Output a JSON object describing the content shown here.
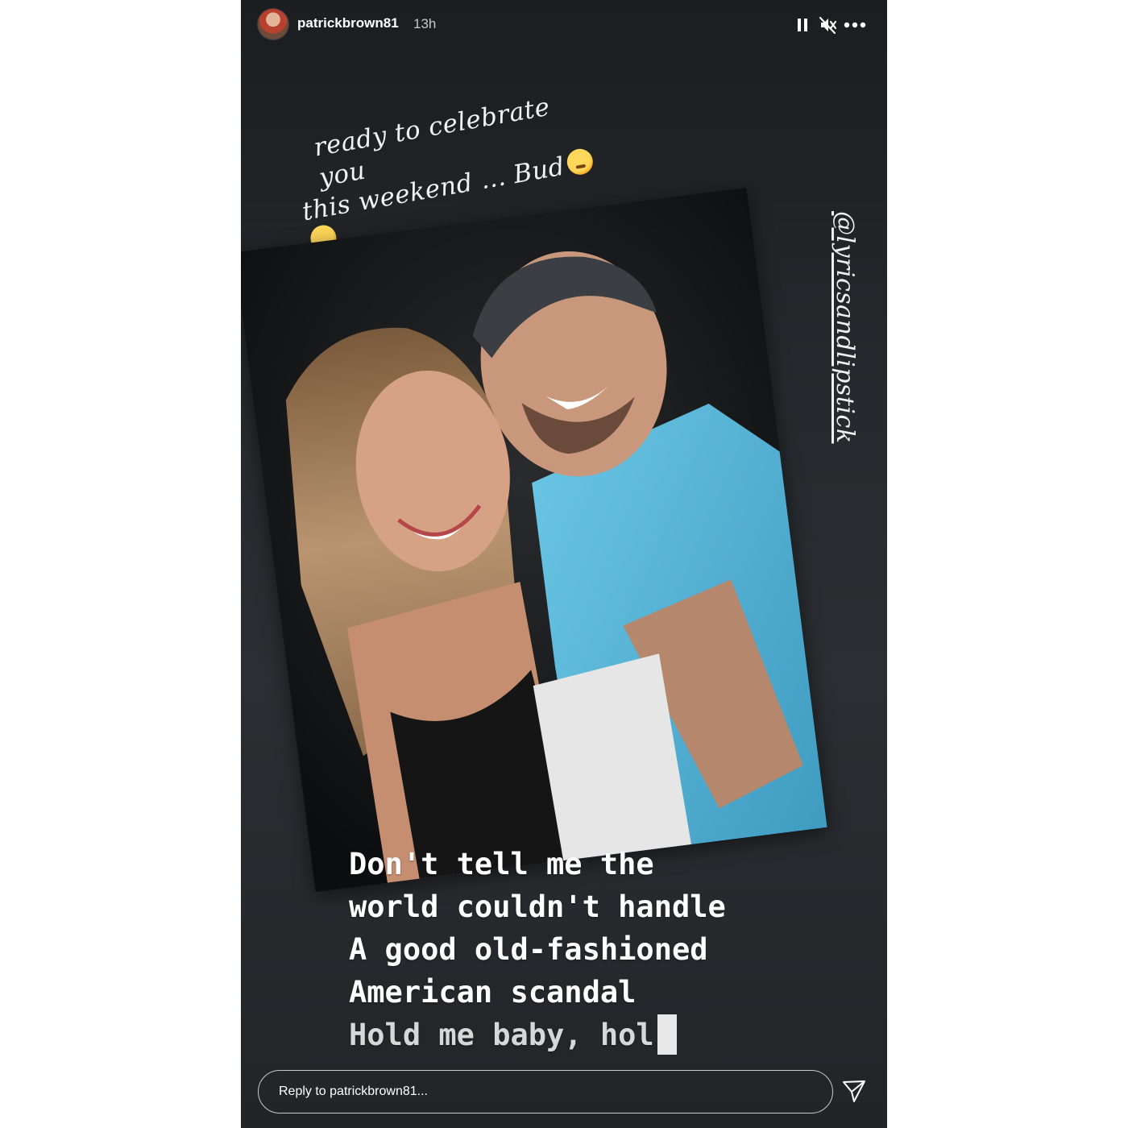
{
  "header": {
    "username": "patrickbrown81",
    "timestamp": "13h",
    "icons": [
      "avatar",
      "pause-icon",
      "mute-icon",
      "more-icon"
    ]
  },
  "caption": {
    "line1": "ready to celebrate you",
    "line2": "this weekend ... Bud"
  },
  "mention": "@lyricsandlipstick",
  "lyrics": {
    "line1": "Don't tell me the",
    "line2": "world couldn't handle",
    "line3": "A good old-fashioned",
    "line4": "American scandal",
    "line5": "Hold me baby, hol"
  },
  "reply": {
    "placeholder": "Reply to patrickbrown81..."
  },
  "colors": {
    "background": "#26292d",
    "text": "#ffffff",
    "shirt": "#5cb8d8"
  }
}
